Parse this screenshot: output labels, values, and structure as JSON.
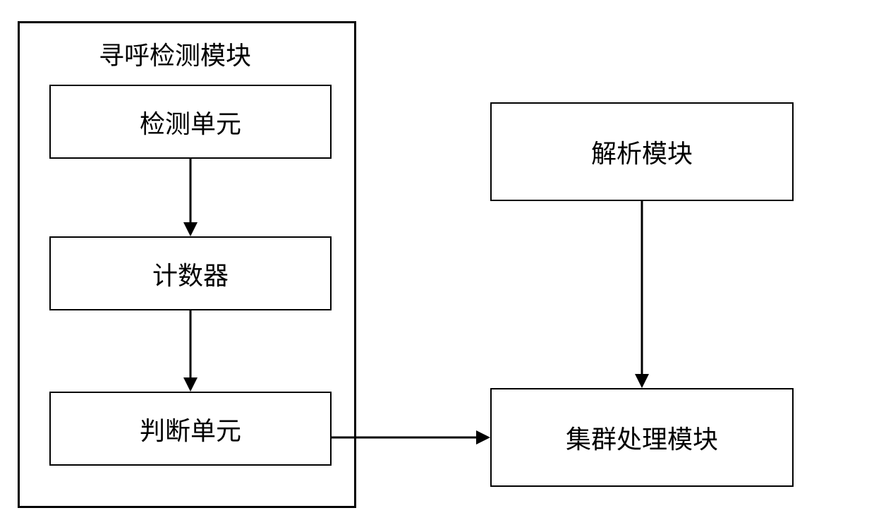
{
  "outerTitle": "寻呼检测模块",
  "boxes": {
    "detectUnit": "检测单元",
    "counter": "计数器",
    "judgeUnit": "判断单元",
    "parseModule": "解析模块",
    "clusterModule": "集群处理模块"
  }
}
